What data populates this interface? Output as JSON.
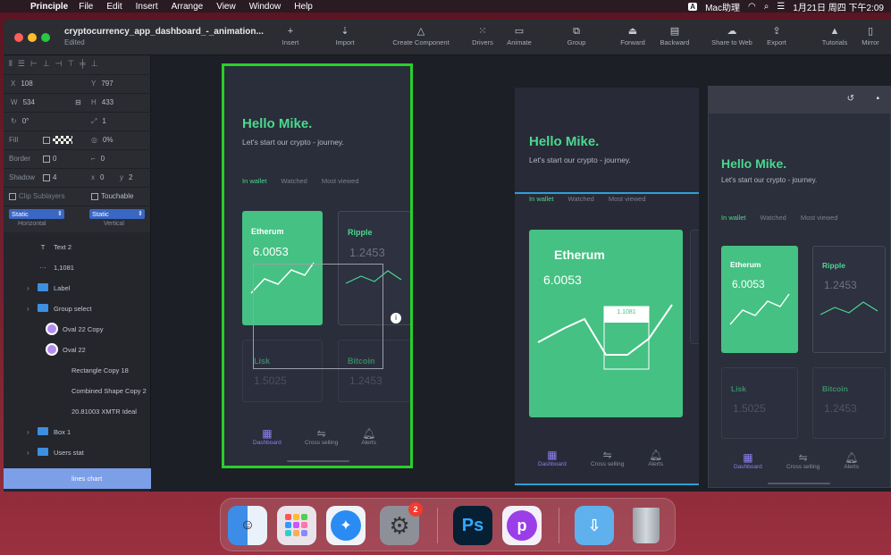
{
  "menubar": {
    "app": "Principle",
    "menus": [
      "File",
      "Edit",
      "Insert",
      "Arrange",
      "View",
      "Window",
      "Help"
    ],
    "ime_badge": "A",
    "ime_label": "Mac助理",
    "clock": "1月21日 周四 下午2:09"
  },
  "document": {
    "title": "cryptocurrency_app_dashboard_-_animation...",
    "subtitle": "Edited"
  },
  "toolbar": {
    "insert": "Insert",
    "import": "Import",
    "create_component": "Create Component",
    "drivers": "Drivers",
    "animate": "Animate",
    "group": "Group",
    "forward": "Forward",
    "backward": "Backward",
    "share_web": "Share to Web",
    "export": "Export",
    "tutorials": "Tutorials",
    "mirror": "Mirror"
  },
  "inspector": {
    "x_label": "X",
    "x": "108",
    "y_label": "Y",
    "y": "797",
    "w_label": "W",
    "w": "534",
    "h_label": "H",
    "h": "433",
    "rotation": "0°",
    "opacity": "1",
    "fill_label": "Fill",
    "fill_opacity": "0%",
    "border_label": "Border",
    "border_w": "0",
    "border_r": "0",
    "shadow_label": "Shadow",
    "shadow_blur": "4",
    "shadow_x": "0",
    "shadow_y": "2",
    "clip_label": "Clip Sublayers",
    "touchable_label": "Touchable",
    "horizontal_value": "Static",
    "horizontal_caption": "Horizontal",
    "vertical_value": "Static",
    "vertical_caption": "Vertical"
  },
  "layers": [
    {
      "name": "Text 2",
      "type": "text"
    },
    {
      "name": "1,1081",
      "type": "shape"
    },
    {
      "name": "Label",
      "type": "folder"
    },
    {
      "name": "Group select",
      "type": "folder"
    },
    {
      "name": "Oval 22 Copy",
      "type": "oval"
    },
    {
      "name": "Oval 22",
      "type": "oval"
    },
    {
      "name": "Rectangle Copy 18",
      "type": "none"
    },
    {
      "name": "Combined Shape Copy 2",
      "type": "none"
    },
    {
      "name": "20.81003 XMTR Ideal",
      "type": "none"
    },
    {
      "name": "Box 1",
      "type": "folder"
    },
    {
      "name": "Users stat",
      "type": "folder"
    },
    {
      "name": "lines chart",
      "type": "selected"
    }
  ],
  "app_screen": {
    "greeting": "Hello Mike.",
    "subtitle": "Let's start our crypto - journey.",
    "tab_wallet": "In wallet",
    "tab_watched": "Watched",
    "tab_most": "Most viewed",
    "card1_name": "Etherum",
    "card1_value": "6.0053",
    "card2_name": "Ripple",
    "card2_value": "1.2453",
    "card3_name": "Lisk",
    "card3_value": "1.5025",
    "card4_name": "Bitcoin",
    "card4_value": "1.2453",
    "nav_dashboard": "Dashboard",
    "nav_cross": "Cross selling",
    "nav_alerts": "Alerts",
    "badge": "1.1081"
  },
  "dock": {
    "photoshop_label": "Ps",
    "settings_badge": "2"
  },
  "colors": {
    "accent_green": "#45c183",
    "selection_green": "#28d02a",
    "selection_blue": "#2e9fd6",
    "nav_active": "#8f7ff0"
  }
}
